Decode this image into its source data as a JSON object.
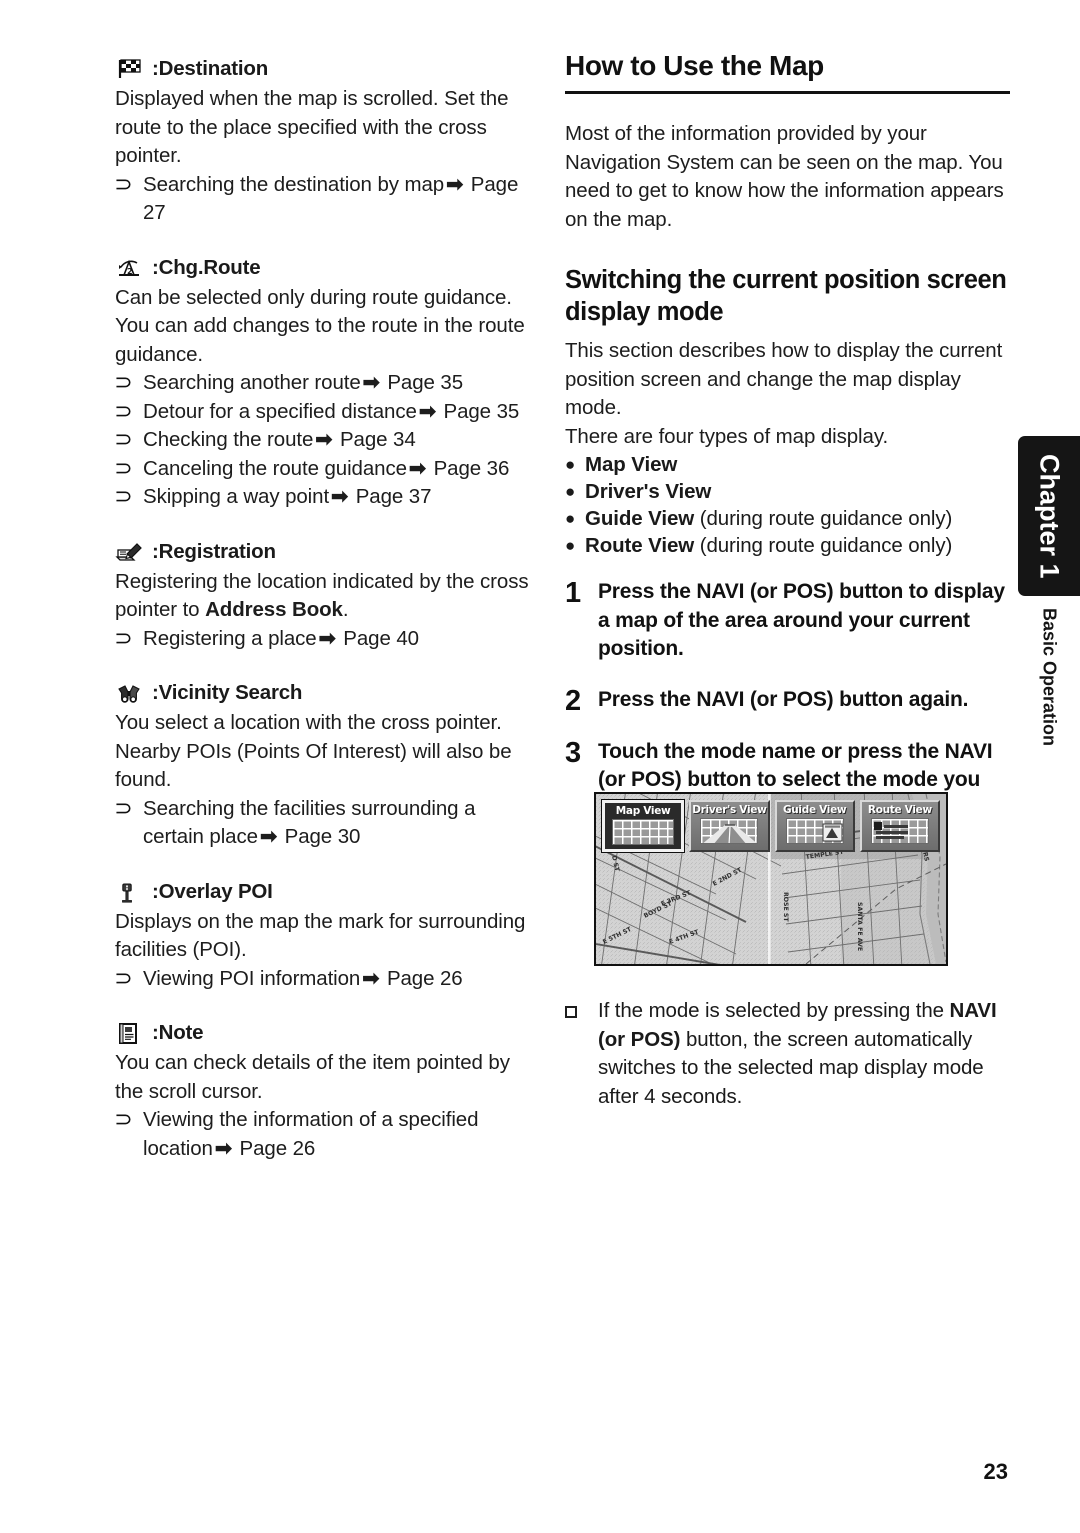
{
  "page": {
    "number": "23",
    "chapter_tab": "Chapter 1",
    "chapter_subtitle": "Basic Operation"
  },
  "left_column": {
    "sections": [
      {
        "icon": "checkered-flag-icon",
        "title": ":Destination",
        "paragraphs": [
          "Displayed when the map is scrolled. Set the route to the place specified with the cross pointer."
        ],
        "refs": [
          {
            "text": "Searching the destination by map",
            "arrow": "➡",
            "page": "Page 27"
          }
        ]
      },
      {
        "icon": "route-change-icon",
        "title": ":Chg.Route",
        "paragraphs": [
          "Can be selected only during route guidance. You can add changes to the route in the route guidance."
        ],
        "refs": [
          {
            "text": "Searching another route",
            "arrow": "➡",
            "page": "Page 35"
          },
          {
            "text": "Detour for a specified distance",
            "arrow": "➡",
            "page": "Page 35"
          },
          {
            "text": "Checking the route",
            "arrow": "➡",
            "page": "Page 34"
          },
          {
            "text": "Canceling the route guidance",
            "arrow": "➡",
            "page": "Page 36"
          },
          {
            "text": "Skipping a way point",
            "arrow": "➡",
            "page": "Page 37"
          }
        ]
      },
      {
        "icon": "pen-notepad-icon",
        "title": ":Registration",
        "paragraphs_rich": [
          {
            "pre": "Registering the location indicated by the cross pointer to ",
            "bold": "Address Book",
            "post": "."
          }
        ],
        "refs": [
          {
            "text": "Registering a place",
            "arrow": "➡",
            "page": "Page 40"
          }
        ]
      },
      {
        "icon": "binoculars-icon",
        "title": ":Vicinity Search",
        "paragraphs": [
          "You select a location with the cross pointer. Nearby POIs (Points Of Interest) will also be found."
        ],
        "refs": [
          {
            "text": "Searching the facilities surrounding a certain place",
            "arrow": "➡",
            "page": "Page 30"
          }
        ]
      },
      {
        "icon": "info-post-icon",
        "title": ":Overlay POI",
        "paragraphs": [
          "Displays on the map the mark for surrounding facilities (POI)."
        ],
        "refs": [
          {
            "text": "Viewing POI information",
            "arrow": "➡",
            "page": "Page 26"
          }
        ]
      },
      {
        "icon": "note-document-icon",
        "title": ":Note",
        "paragraphs": [
          "You can check details of the item pointed by the scroll cursor."
        ],
        "refs": [
          {
            "text": "Viewing the information of a specified location",
            "arrow": "➡",
            "page": "Page 26"
          }
        ]
      }
    ]
  },
  "right_column": {
    "heading_1": "How to Use the Map",
    "intro_paragraph": "Most of the information provided by your Navigation System can be seen on the map. You need to get to know how the information appears on the map.",
    "heading_2": "Switching the current position screen display mode",
    "description_paragraph": "This section describes how to display the current position screen and change the map display mode.",
    "types_intro": "There are four types of map display.",
    "view_types": [
      {
        "name": "Map View",
        "qualifier": ""
      },
      {
        "name": "Driver's View",
        "qualifier": ""
      },
      {
        "name": "Guide View",
        "qualifier": " (during route guidance only)"
      },
      {
        "name": "Route View",
        "qualifier": " (during route guidance only)"
      }
    ],
    "steps": [
      {
        "number": "1",
        "parts": [
          {
            "t": "Press the ",
            "b": false
          },
          {
            "t": "NAVI",
            "b": true
          },
          {
            "t": " (or ",
            "b": false
          },
          {
            "t": "POS",
            "b": true
          },
          {
            "t": ") button to display a map of the area around your current position.",
            "b": false
          }
        ]
      },
      {
        "number": "2",
        "parts": [
          {
            "t": "Press the ",
            "b": false
          },
          {
            "t": "NAVI",
            "b": true
          },
          {
            "t": " (or ",
            "b": false
          },
          {
            "t": "POS",
            "b": true
          },
          {
            "t": ") button again.",
            "b": false
          }
        ]
      },
      {
        "number": "3",
        "parts": [
          {
            "t": "Touch the mode name or press the ",
            "b": false
          },
          {
            "t": "NAVI",
            "b": true
          },
          {
            "t": " (or ",
            "b": false
          },
          {
            "t": "POS",
            "b": true
          },
          {
            "t": ") button to select the mode you want to display.",
            "b": false
          }
        ]
      }
    ],
    "note": {
      "pre": "If the mode is selected by pressing the ",
      "bold": "NAVI (or POS)",
      "post": " button, the screen automatically switches to the selected map display mode after 4 seconds."
    }
  },
  "figure": {
    "name": "map-display-mode-selection-screenshot",
    "mode_buttons": [
      {
        "label": "Map View",
        "selected": true,
        "thumb": "grid"
      },
      {
        "label": "Driver's View",
        "selected": false,
        "thumb": "perspective"
      },
      {
        "label": "Guide View",
        "selected": false,
        "thumb": "guide"
      },
      {
        "label": "Route View",
        "selected": false,
        "thumb": "route"
      }
    ],
    "street_labels": [
      "E 2ND ST",
      "E 3RD ST",
      "BOYD ST",
      "E 4TH ST",
      "E 5TH ST",
      "TEMPLE ST",
      "ROSE ST",
      "SANTA FE AVE",
      "D ST",
      "MYERS ST",
      "2N"
    ]
  }
}
